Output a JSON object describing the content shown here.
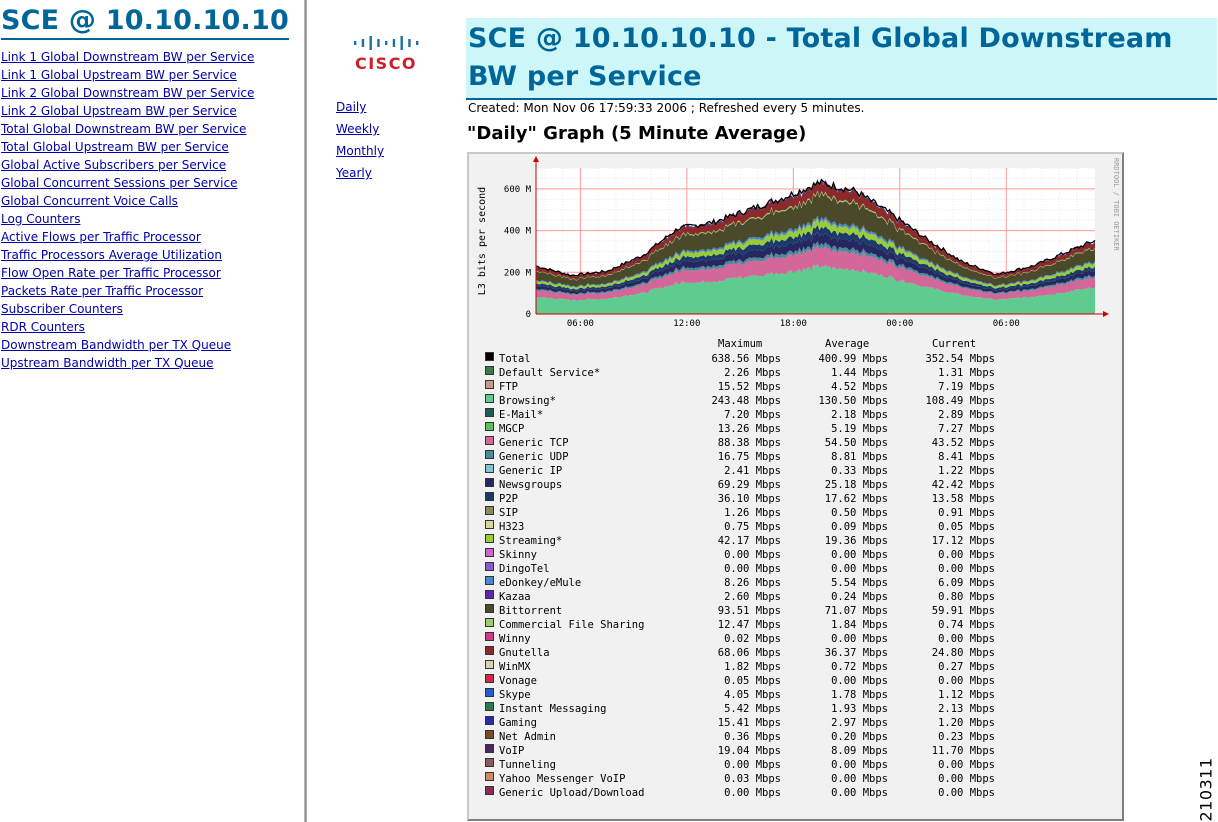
{
  "left_nav": {
    "title": "SCE @ 10.10.10.10",
    "links": [
      "Link 1 Global Downstream BW per Service",
      "Link 1 Global Upstream BW per Service",
      "Link 2 Global Downstream BW per Service",
      "Link 2 Global Upstream BW per Service",
      "Total Global Downstream BW per Service",
      "Total Global Upstream BW per Service",
      "Global Active Subscribers per Service",
      "Global Concurrent Sessions per Service",
      "Global Concurrent Voice Calls",
      "Log Counters",
      "Active Flows per Traffic Processor",
      "Traffic Processors Average Utilization",
      "Flow Open Rate per Traffic Processor",
      "Packets Rate per Traffic Processor",
      "Subscriber Counters",
      "RDR Counters",
      "Downstream Bandwidth per TX Queue",
      "Upstream Bandwidth per TX Queue"
    ]
  },
  "logo": {
    "word": "CISCO",
    "color": "#cc1f2a",
    "bars_color": "#1f6fa8"
  },
  "period_links": [
    "Daily",
    "Weekly",
    "Monthly",
    "Yearly"
  ],
  "main": {
    "title": "SCE @ 10.10.10.10 - Total Global Downstream BW per Service",
    "created": "Created: Mon Nov 06 17:59:33 2006 ; Refreshed every 5 minutes.",
    "graph_heading": "\"Daily\" Graph (5 Minute Average)"
  },
  "chart_data": {
    "type": "area",
    "stacked": true,
    "ylabel": "L3 bits per second",
    "yticks": [
      "0",
      "200 M",
      "400 M",
      "600 M"
    ],
    "ylim": [
      0,
      700
    ],
    "y_unit": "Mbps",
    "xticks": [
      "06:00",
      "12:00",
      "18:00",
      "00:00",
      "06:00"
    ],
    "side_text": "RRDTOOL / TOBI OETIKER",
    "grid": true,
    "total_profile": {
      "x_hours_from_start": [
        0,
        2,
        4,
        6,
        8,
        10,
        12,
        14,
        16,
        18,
        20,
        22,
        24,
        26,
        28,
        30,
        31.5
      ],
      "total_mbps": [
        230,
        185,
        205,
        280,
        410,
        440,
        500,
        560,
        630,
        590,
        480,
        360,
        250,
        190,
        230,
        300,
        352
      ]
    },
    "legend_columns": [
      "Maximum",
      "Average",
      "Current"
    ],
    "series": [
      {
        "name": "Total",
        "color": "#000000",
        "max": "638.56 Mbps",
        "avg": "400.99 Mbps",
        "cur": "352.54 Mbps"
      },
      {
        "name": "Default Service*",
        "color": "#3f7a4a",
        "max": "2.26 Mbps",
        "avg": "1.44 Mbps",
        "cur": "1.31 Mbps"
      },
      {
        "name": "FTP",
        "color": "#c49a8c",
        "max": "15.52 Mbps",
        "avg": "4.52 Mbps",
        "cur": "7.19 Mbps"
      },
      {
        "name": "Browsing*",
        "color": "#5fcc8f",
        "max": "243.48 Mbps",
        "avg": "130.50 Mbps",
        "cur": "108.49 Mbps"
      },
      {
        "name": "E-Mail*",
        "color": "#1e5a50",
        "max": "7.20 Mbps",
        "avg": "2.18 Mbps",
        "cur": "2.89 Mbps"
      },
      {
        "name": "MGCP",
        "color": "#5abf5a",
        "max": "13.26 Mbps",
        "avg": "5.19 Mbps",
        "cur": "7.27 Mbps"
      },
      {
        "name": "Generic TCP",
        "color": "#d4679a",
        "max": "88.38 Mbps",
        "avg": "54.50 Mbps",
        "cur": "43.52 Mbps"
      },
      {
        "name": "Generic UDP",
        "color": "#4a8a9a",
        "max": "16.75 Mbps",
        "avg": "8.81 Mbps",
        "cur": "8.41 Mbps"
      },
      {
        "name": "Generic IP",
        "color": "#7fc4d4",
        "max": "2.41 Mbps",
        "avg": "0.33 Mbps",
        "cur": "1.22 Mbps"
      },
      {
        "name": "Newsgroups",
        "color": "#262660",
        "max": "69.29 Mbps",
        "avg": "25.18 Mbps",
        "cur": "42.42 Mbps"
      },
      {
        "name": "P2P",
        "color": "#1a3a6a",
        "max": "36.10 Mbps",
        "avg": "17.62 Mbps",
        "cur": "13.58 Mbps"
      },
      {
        "name": "SIP",
        "color": "#8a8a5a",
        "max": "1.26 Mbps",
        "avg": "0.50 Mbps",
        "cur": "0.91 Mbps"
      },
      {
        "name": "H323",
        "color": "#d8d89a",
        "max": "0.75 Mbps",
        "avg": "0.09 Mbps",
        "cur": "0.05 Mbps"
      },
      {
        "name": "Streaming*",
        "color": "#9acc3a",
        "max": "42.17 Mbps",
        "avg": "19.36 Mbps",
        "cur": "17.12 Mbps"
      },
      {
        "name": "Skinny",
        "color": "#cc66cc",
        "max": "0.00 Mbps",
        "avg": "0.00 Mbps",
        "cur": "0.00 Mbps"
      },
      {
        "name": "DingoTel",
        "color": "#8a5acc",
        "max": "0.00 Mbps",
        "avg": "0.00 Mbps",
        "cur": "0.00 Mbps"
      },
      {
        "name": "eDonkey/eMule",
        "color": "#4a8acc",
        "max": "8.26 Mbps",
        "avg": "5.54 Mbps",
        "cur": "6.09 Mbps"
      },
      {
        "name": "Kazaa",
        "color": "#5a2aaa",
        "max": "2.60 Mbps",
        "avg": "0.24 Mbps",
        "cur": "0.80 Mbps"
      },
      {
        "name": "Bittorrent",
        "color": "#4a4a2a",
        "max": "93.51 Mbps",
        "avg": "71.07 Mbps",
        "cur": "59.91 Mbps"
      },
      {
        "name": "Commercial File Sharing",
        "color": "#9acc6a",
        "max": "12.47 Mbps",
        "avg": "1.84 Mbps",
        "cur": "0.74 Mbps"
      },
      {
        "name": "Winny",
        "color": "#cc3a8a",
        "max": "0.02 Mbps",
        "avg": "0.00 Mbps",
        "cur": "0.00 Mbps"
      },
      {
        "name": "Gnutella",
        "color": "#8a2a2a",
        "max": "68.06 Mbps",
        "avg": "36.37 Mbps",
        "cur": "24.80 Mbps"
      },
      {
        "name": "WinMX",
        "color": "#d8d0b0",
        "max": "1.82 Mbps",
        "avg": "0.72 Mbps",
        "cur": "0.27 Mbps"
      },
      {
        "name": "Vonage",
        "color": "#cc2a4a",
        "max": "0.05 Mbps",
        "avg": "0.00 Mbps",
        "cur": "0.00 Mbps"
      },
      {
        "name": "Skype",
        "color": "#2a5acc",
        "max": "4.05 Mbps",
        "avg": "1.78 Mbps",
        "cur": "1.12 Mbps"
      },
      {
        "name": "Instant Messaging",
        "color": "#2a7a4a",
        "max": "5.42 Mbps",
        "avg": "1.93 Mbps",
        "cur": "2.13 Mbps"
      },
      {
        "name": "Gaming",
        "color": "#2a2aaa",
        "max": "15.41 Mbps",
        "avg": "2.97 Mbps",
        "cur": "1.20 Mbps"
      },
      {
        "name": "Net Admin",
        "color": "#7a4a2a",
        "max": "0.36 Mbps",
        "avg": "0.20 Mbps",
        "cur": "0.23 Mbps"
      },
      {
        "name": "VoIP",
        "color": "#4a2a5a",
        "max": "19.04 Mbps",
        "avg": "8.09 Mbps",
        "cur": "11.70 Mbps"
      },
      {
        "name": "Tunneling",
        "color": "#8a5a5a",
        "max": "0.00 Mbps",
        "avg": "0.00 Mbps",
        "cur": "0.00 Mbps"
      },
      {
        "name": "Yahoo Messenger VoIP",
        "color": "#cc8a6a",
        "max": "0.03 Mbps",
        "avg": "0.00 Mbps",
        "cur": "0.00 Mbps"
      },
      {
        "name": "Generic Upload/Download",
        "color": "#8a2a5a",
        "max": "0.00 Mbps",
        "avg": "0.00 Mbps",
        "cur": "0.00 Mbps"
      }
    ]
  },
  "figure_id": "210311"
}
